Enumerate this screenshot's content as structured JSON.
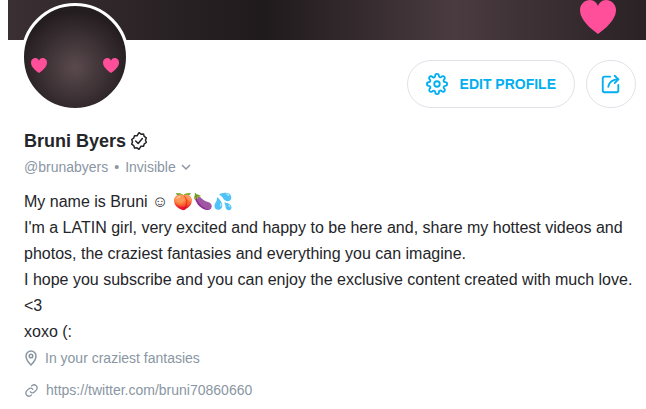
{
  "profile": {
    "name": "Bruni Byers",
    "verified": true,
    "handle": "@brunabyers",
    "separator": "•",
    "status": "Invisible",
    "bio": [
      "My name is Bruni ☺ 🍑🍆💦",
      "I'm a LATIN girl, very excited and happy to be here and, share my hottest videos and photos, the craziest fantasies and everything you can imagine.",
      "I hope you subscribe and you can enjoy the exclusive content created with much love. <3",
      "xoxo (:"
    ],
    "location": "In your craziest fantasies",
    "link": "https://twitter.com/bruni70860660"
  },
  "buttons": {
    "edit": "EDIT PROFILE"
  }
}
